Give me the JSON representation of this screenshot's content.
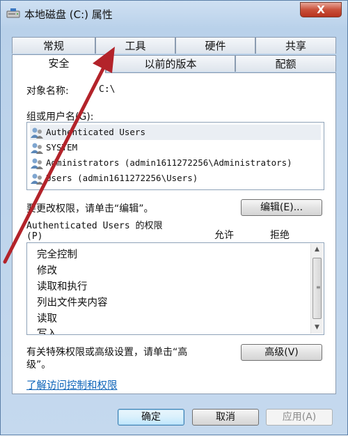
{
  "window": {
    "title": "本地磁盘 (C:) 属性",
    "close_label": "X"
  },
  "tabs": {
    "row1": [
      {
        "label": "常规"
      },
      {
        "label": "工具"
      },
      {
        "label": "硬件"
      },
      {
        "label": "共享"
      }
    ],
    "row2": [
      {
        "label": "安全"
      },
      {
        "label": "以前的版本"
      },
      {
        "label": "配额"
      }
    ],
    "active": "安全"
  },
  "security": {
    "object_label": "对象名称:",
    "object_value": "C:\\",
    "users_label": "组或用户名(G):",
    "users": [
      {
        "name": "Authenticated Users"
      },
      {
        "name": "SYSTEM"
      },
      {
        "name": "Administrators (admin1611272256\\Administrators)"
      },
      {
        "name": "Users (admin1611272256\\Users)"
      }
    ],
    "edit_hint": "要更改权限，请单击“编辑”。",
    "edit_button": "编辑(E)...",
    "perm_title": "Authenticated Users 的权限",
    "perm_title_key": "(P)",
    "allow_header": "允许",
    "deny_header": "拒绝",
    "permissions": [
      {
        "name": "完全控制"
      },
      {
        "name": "修改"
      },
      {
        "name": "读取和执行"
      },
      {
        "name": "列出文件夹内容"
      },
      {
        "name": "读取"
      },
      {
        "name": "写入"
      }
    ],
    "advanced_hint_1": "有关特殊权限或高级设置，请单击“高",
    "advanced_hint_2": "级”。",
    "advanced_button": "高级(V)",
    "learn_link": "了解访问控制和权限"
  },
  "footer": {
    "ok": "确定",
    "cancel": "取消",
    "apply": "应用(A)"
  },
  "colors": {
    "accent_arrow": "#b3232a",
    "link": "#0a62b8"
  }
}
